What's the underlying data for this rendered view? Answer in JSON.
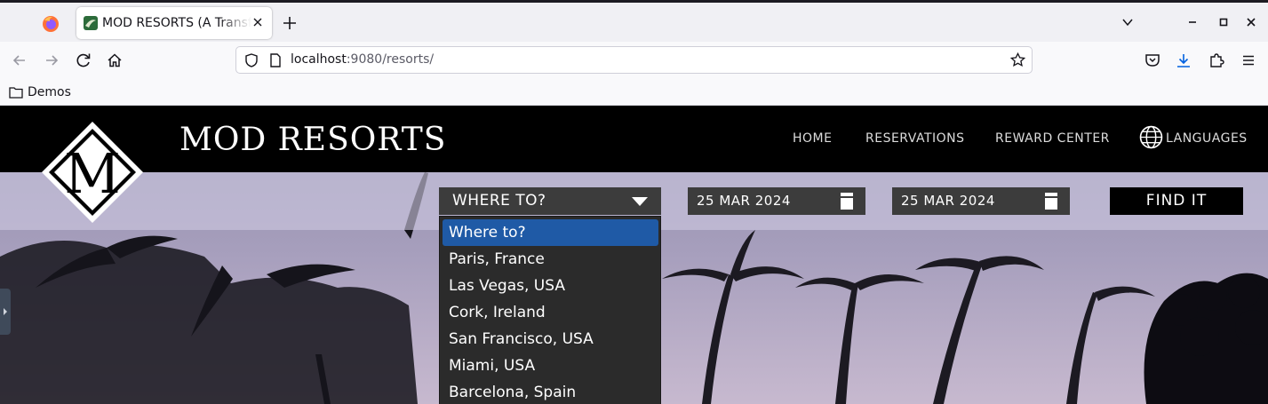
{
  "browser": {
    "tab_title": "MOD RESORTS (A Transformation",
    "url_host": "localhost",
    "url_rest": ":9080/resorts/",
    "bookmarks": [
      {
        "label": "Demos"
      }
    ]
  },
  "site": {
    "logo_letter": "M",
    "title": "MOD RESORTS",
    "nav": {
      "home": "HOME",
      "reservations": "RESERVATIONS",
      "reward_center": "REWARD CENTER",
      "languages": "LANGUAGES"
    }
  },
  "search": {
    "where_label": "WHERE TO?",
    "checkin": "25 MAR 2024",
    "checkout": "25 MAR 2024",
    "find_label": "FIND IT",
    "options": [
      {
        "label": "Where to?",
        "selected": true
      },
      {
        "label": "Paris, France"
      },
      {
        "label": "Las Vegas, USA"
      },
      {
        "label": "Cork, Ireland"
      },
      {
        "label": "San Francisco, USA"
      },
      {
        "label": "Miami, USA"
      },
      {
        "label": "Barcelona, Spain"
      }
    ]
  },
  "colors": {
    "header_bg": "#000000",
    "select_bg": "#3c3c3c",
    "dropdown_bg": "#2b2b2b",
    "selected_option": "#1f5aa6",
    "search_band": "#cdc8e1"
  }
}
